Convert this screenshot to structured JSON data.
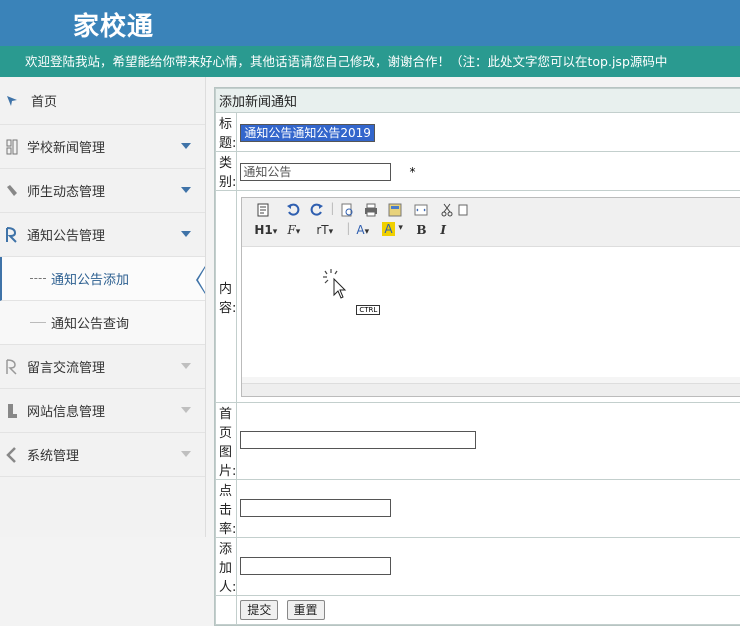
{
  "header": {
    "title": "家校通"
  },
  "banner": {
    "text": "欢迎登陆我站，希望能给你带来好心情，其他话语请您自己修改，谢谢合作！（注：此处文字您可以在top.jsp源码中"
  },
  "sidebar": {
    "home": "首页",
    "items": [
      {
        "label": "学校新闻管理"
      },
      {
        "label": "师生动态管理"
      },
      {
        "label": "通知公告管理"
      },
      {
        "label": "留言交流管理"
      },
      {
        "label": "网站信息管理"
      },
      {
        "label": "系统管理"
      }
    ],
    "sub_items": [
      {
        "label": "通知公告添加"
      },
      {
        "label": "通知公告查询"
      }
    ]
  },
  "form": {
    "caption": "添加新闻通知",
    "title_label": "标题:",
    "title_value": "通知公告通知公告2019",
    "category_label": "类别:",
    "category_value": "通知公告",
    "required_mark": "*",
    "content_label": "内容:",
    "image_label": "首页图片:",
    "clicks_label": "点击率:",
    "adder_label": "添加人:",
    "submit_label": "提交",
    "reset_label": "重置"
  },
  "editor": {
    "heading_btn": "H1",
    "font_btn": "F",
    "size_btn": "rT",
    "font_color_btn": "A",
    "bg_color_btn": "A",
    "bold_btn": "B",
    "italic_btn": "I",
    "ctrl_hint": "CTRL"
  },
  "colors": {
    "header": "#3a83b9",
    "banner": "#2a9a90",
    "accent": "#3f73a8"
  }
}
